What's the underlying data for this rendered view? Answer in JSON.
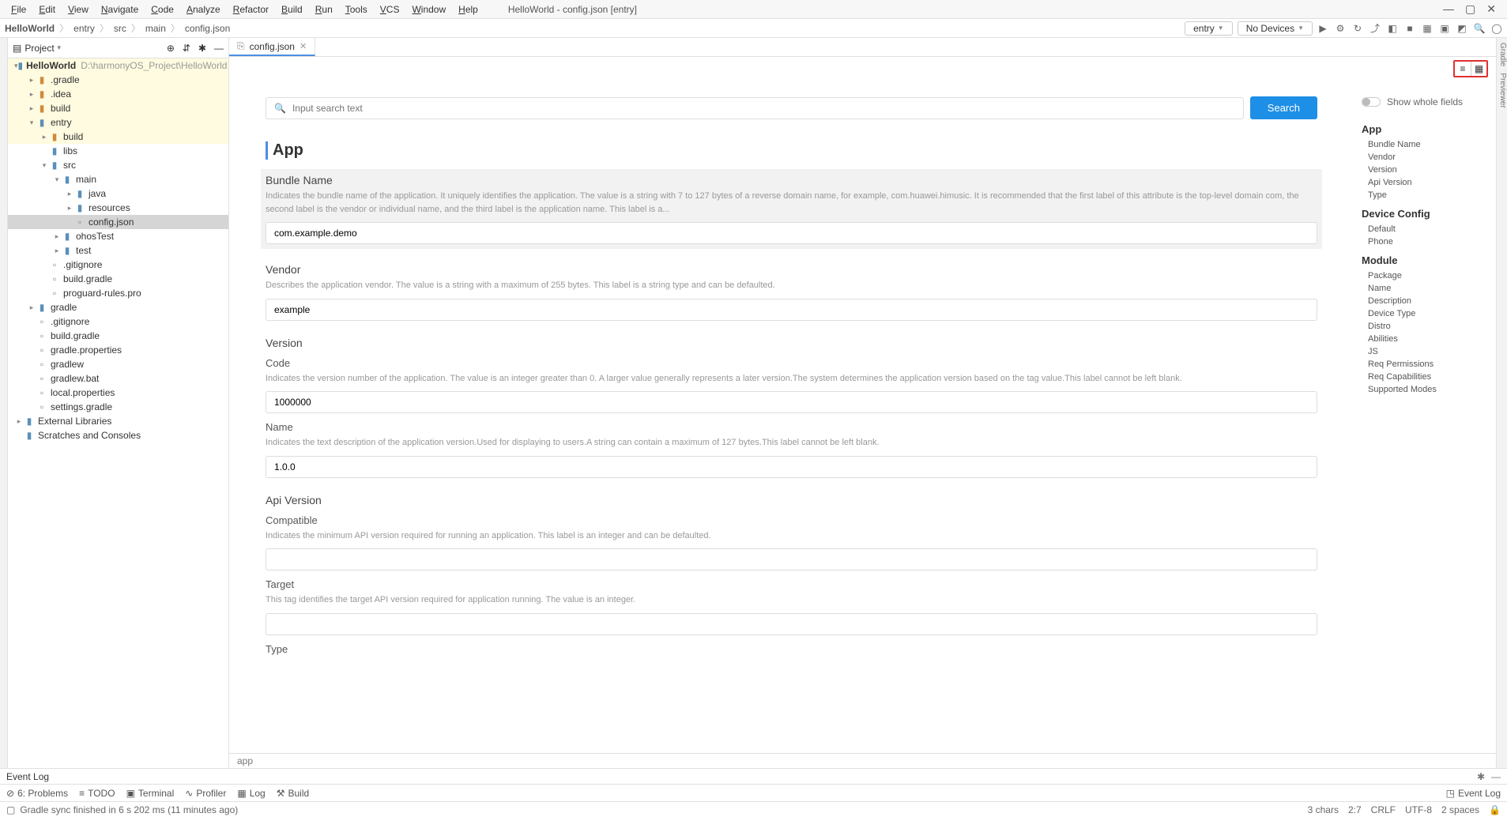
{
  "window": {
    "title": "HelloWorld - config.json [entry]",
    "menu": [
      "File",
      "Edit",
      "View",
      "Navigate",
      "Code",
      "Analyze",
      "Refactor",
      "Build",
      "Run",
      "Tools",
      "VCS",
      "Window",
      "Help"
    ]
  },
  "breadcrumb": [
    "HelloWorld",
    "entry",
    "src",
    "main",
    "config.json"
  ],
  "run": {
    "config": "entry",
    "device": "No Devices"
  },
  "project": {
    "label": "Project",
    "tree": [
      {
        "d": 0,
        "a": "v",
        "ic": "fldb",
        "t": "HelloWorld",
        "path": "D:\\harmonyOS_Project\\HelloWorld",
        "hl": true,
        "bold": true
      },
      {
        "d": 1,
        "a": ">",
        "ic": "fld",
        "t": ".gradle",
        "hl": true
      },
      {
        "d": 1,
        "a": ">",
        "ic": "fld",
        "t": ".idea",
        "hl": true
      },
      {
        "d": 1,
        "a": ">",
        "ic": "fld",
        "t": "build",
        "hl": true
      },
      {
        "d": 1,
        "a": "v",
        "ic": "fldb",
        "t": "entry",
        "hl": true
      },
      {
        "d": 2,
        "a": ">",
        "ic": "fld",
        "t": "build",
        "hl": true
      },
      {
        "d": 2,
        "a": "",
        "ic": "fldb",
        "t": "libs"
      },
      {
        "d": 2,
        "a": "v",
        "ic": "fldb",
        "t": "src"
      },
      {
        "d": 3,
        "a": "v",
        "ic": "fldb",
        "t": "main"
      },
      {
        "d": 4,
        "a": ">",
        "ic": "fldb",
        "t": "java"
      },
      {
        "d": 4,
        "a": ">",
        "ic": "fldb",
        "t": "resources"
      },
      {
        "d": 4,
        "a": "",
        "ic": "fil",
        "t": "config.json",
        "sel": true
      },
      {
        "d": 3,
        "a": ">",
        "ic": "fldb",
        "t": "ohosTest"
      },
      {
        "d": 3,
        "a": ">",
        "ic": "fldb",
        "t": "test"
      },
      {
        "d": 2,
        "a": "",
        "ic": "fil",
        "t": ".gitignore"
      },
      {
        "d": 2,
        "a": "",
        "ic": "fil",
        "t": "build.gradle"
      },
      {
        "d": 2,
        "a": "",
        "ic": "fil",
        "t": "proguard-rules.pro"
      },
      {
        "d": 1,
        "a": ">",
        "ic": "fldb",
        "t": "gradle"
      },
      {
        "d": 1,
        "a": "",
        "ic": "fil",
        "t": ".gitignore"
      },
      {
        "d": 1,
        "a": "",
        "ic": "fil",
        "t": "build.gradle"
      },
      {
        "d": 1,
        "a": "",
        "ic": "fil",
        "t": "gradle.properties"
      },
      {
        "d": 1,
        "a": "",
        "ic": "fil",
        "t": "gradlew"
      },
      {
        "d": 1,
        "a": "",
        "ic": "fil",
        "t": "gradlew.bat"
      },
      {
        "d": 1,
        "a": "",
        "ic": "fil",
        "t": "local.properties"
      },
      {
        "d": 1,
        "a": "",
        "ic": "fil",
        "t": "settings.gradle"
      },
      {
        "d": 0,
        "a": ">",
        "ic": "fldb",
        "t": "External Libraries"
      },
      {
        "d": 0,
        "a": "",
        "ic": "fldb",
        "t": "Scratches and Consoles"
      }
    ]
  },
  "tab": {
    "name": "config.json"
  },
  "search": {
    "placeholder": "Input search text",
    "button": "Search"
  },
  "form": {
    "title": "App",
    "bundle": {
      "label": "Bundle Name",
      "desc": "Indicates the bundle name of the application. It uniquely identifies the application. The value is a string with 7 to 127 bytes of a reverse domain name, for example, com.huawei.himusic. It is recommended that the first label of this attribute is the top-level domain com, the second label is the vendor or individual name, and the third label is the application name. This label is a...",
      "value": "com.example.demo"
    },
    "vendor": {
      "label": "Vendor",
      "desc": "Describes the application vendor. The value is a string with a maximum of 255 bytes. This label is a string type and can be defaulted.",
      "value": "example"
    },
    "version": {
      "label": "Version",
      "code_label": "Code",
      "code_desc": "Indicates the version number of the application. The value is an integer greater than 0. A larger value generally represents a later version.The system determines the application version based on the tag value.This label cannot be left blank.",
      "code_value": "1000000",
      "name_label": "Name",
      "name_desc": "Indicates the text description of the application version.Used for displaying to users.A string can contain a maximum of 127 bytes.This label cannot be left blank.",
      "name_value": "1.0.0"
    },
    "api": {
      "label": "Api Version",
      "compat_label": "Compatible",
      "compat_desc": "Indicates the minimum API version required for running an application. This label is an integer and can be defaulted.",
      "compat_value": "",
      "target_label": "Target",
      "target_desc": "This tag identifies the target API version required for application running. The value is an integer.",
      "target_value": "",
      "type_label": "Type"
    },
    "crumb": "app"
  },
  "nav": {
    "toggle": "Show whole fields",
    "sections": [
      {
        "title": "App",
        "items": [
          "Bundle Name",
          "Vendor",
          "Version",
          "Api Version",
          "Type"
        ]
      },
      {
        "title": "Device Config",
        "items": [
          "Default",
          "Phone"
        ]
      },
      {
        "title": "Module",
        "items": [
          "Package",
          "Name",
          "Description",
          "Device Type",
          "Distro",
          "Abilities",
          "JS",
          "Req Permissions",
          "Req Capabilities",
          "Supported Modes"
        ]
      }
    ]
  },
  "sidebarLabels": {
    "gradle": "Gradle",
    "previewer": "Previewer"
  },
  "eventlog": "Event Log",
  "bottomtools": [
    "6: Problems",
    "TODO",
    "Terminal",
    "Profiler",
    "Log",
    "Build"
  ],
  "status": {
    "msg": "Gradle sync finished in 6 s 202 ms (11 minutes ago)",
    "chars": "3 chars",
    "pos": "2:7",
    "eol": "CRLF",
    "enc": "UTF-8",
    "indent": "2 spaces"
  }
}
